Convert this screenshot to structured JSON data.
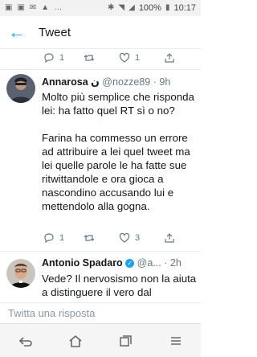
{
  "status_bar": {
    "battery": "100%",
    "time": "10:17"
  },
  "header": {
    "title": "Tweet",
    "back_icon": "arrow-left-icon"
  },
  "top_actions": {
    "reply_count": "1",
    "like_count": "1"
  },
  "tweets": [
    {
      "author_name": "Annarosa",
      "author_suffix": "ن",
      "handle": "@nozze89",
      "time": "9h",
      "body": [
        "Molto più semplice che risponda lei: ha fatto quel RT sì o no?",
        "Farina ha commesso un errore ad attribuire a lei quel tweet ma lei quelle parole le ha fatte sue ritwittandole e ora gioca a nascondino accusando lui e mettendolo alla gogna."
      ],
      "reply_count": "1",
      "like_count": "3"
    },
    {
      "author_name": "Antonio Spadaro",
      "handle": "@a...",
      "time": "2h",
      "body": [
        "Vede? Il nervosismo non la aiuta a distinguere il vero dal"
      ]
    }
  ],
  "reply_box": {
    "placeholder": "Twitta una risposta"
  },
  "colors": {
    "accent": "#1da1f2",
    "muted": "#657786"
  }
}
